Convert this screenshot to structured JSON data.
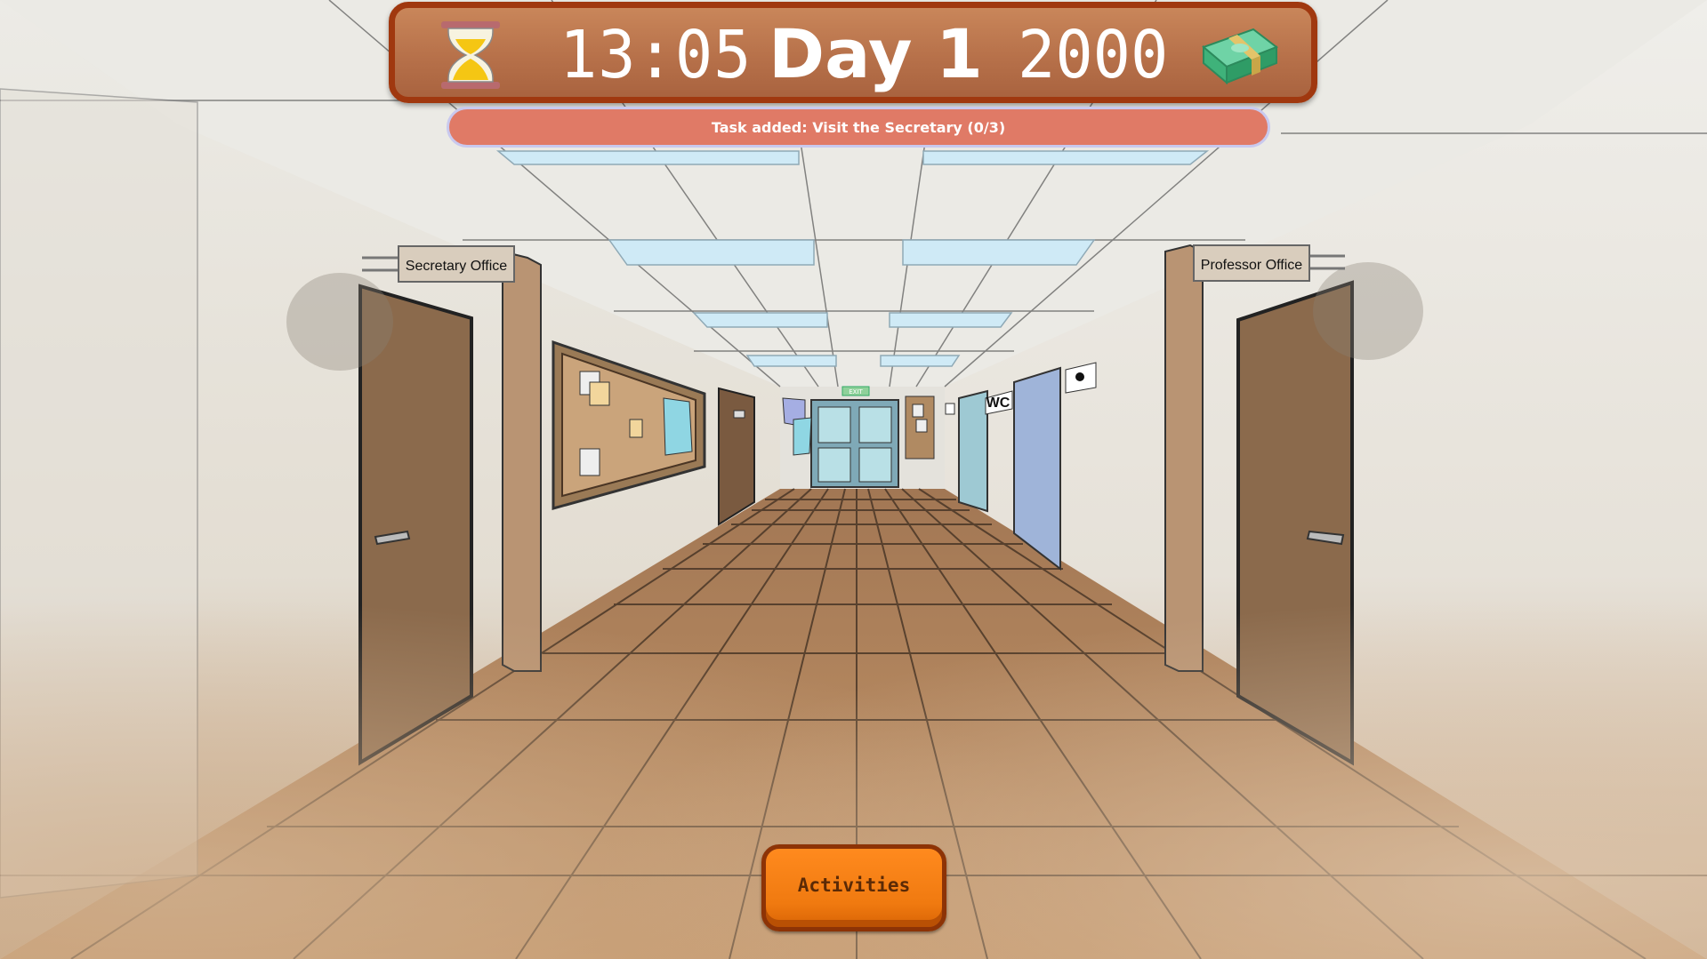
{
  "hud": {
    "time": "13:05",
    "day": "Day 1",
    "money": "2000",
    "icons": [
      "hourglass-icon",
      "cash-stack-icon"
    ]
  },
  "notification": {
    "text": "Task added: Visit the Secretary (0/3)"
  },
  "signs": {
    "left": "Secretary Office",
    "right": "Professor Office",
    "wc": "WC",
    "exit": "EXIT"
  },
  "buttons": {
    "activities": "Activities"
  },
  "colors": {
    "hud_bg": "#b7714a",
    "hud_border": "#a0380f",
    "notice_bg": "#e07a66",
    "button": "#f07a10",
    "floor": "#b8865a",
    "door": "#8b6a4c"
  }
}
